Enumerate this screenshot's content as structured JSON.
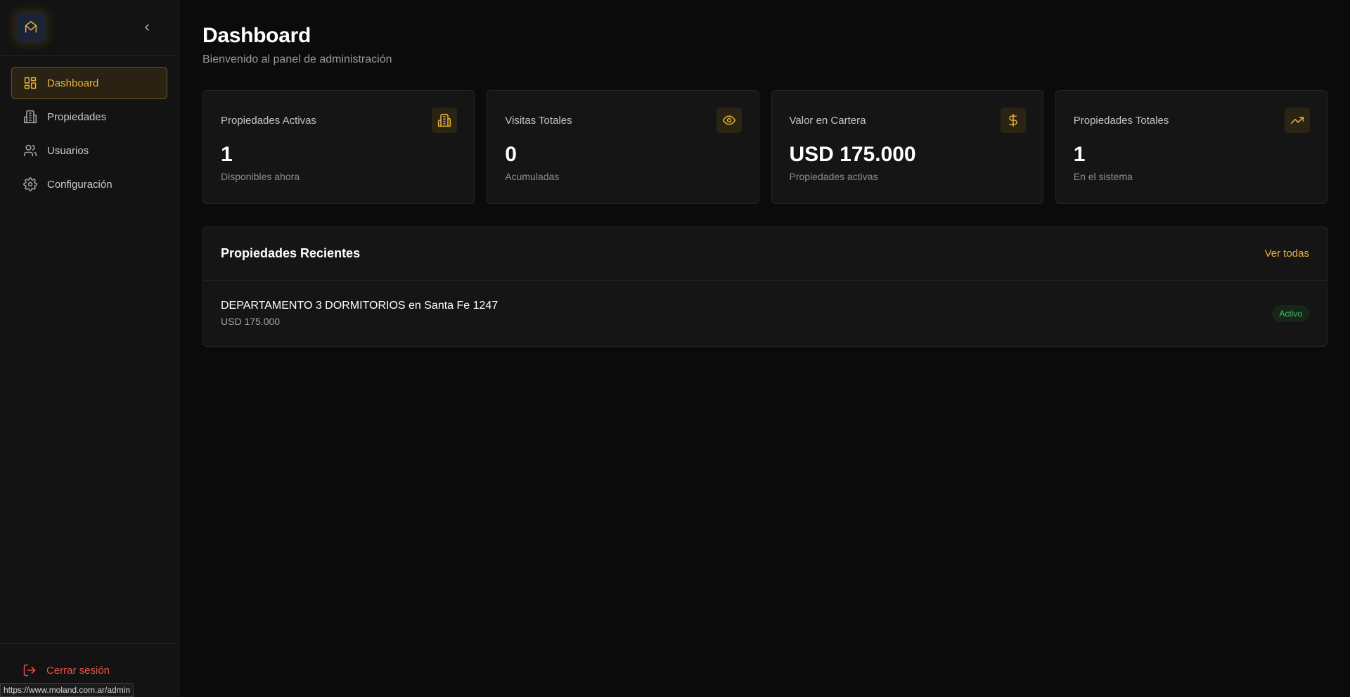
{
  "colors": {
    "accent": "#e8b33a",
    "danger": "#e5534b",
    "success": "#4bc46a",
    "background": "#0b0b0b",
    "sidebar": "#131313"
  },
  "sidebar": {
    "logo_icon": "moland-logo-icon",
    "collapse_icon": "chevron-left-icon",
    "items": [
      {
        "label": "Dashboard",
        "icon": "dashboard-grid-icon",
        "active": true
      },
      {
        "label": "Propiedades",
        "icon": "building-icon",
        "active": false
      },
      {
        "label": "Usuarios",
        "icon": "users-icon",
        "active": false
      },
      {
        "label": "Configuración",
        "icon": "gear-icon",
        "active": false
      }
    ],
    "logout": {
      "label": "Cerrar sesión",
      "icon": "logout-icon"
    }
  },
  "status_bar": {
    "url": "https://www.moland.com.ar/admin"
  },
  "header": {
    "title": "Dashboard",
    "subtitle": "Bienvenido al panel de administración"
  },
  "stats": [
    {
      "label": "Propiedades Activas",
      "value": "1",
      "sub": "Disponibles ahora",
      "icon": "building-icon"
    },
    {
      "label": "Visitas Totales",
      "value": "0",
      "sub": "Acumuladas",
      "icon": "eye-icon"
    },
    {
      "label": "Valor en Cartera",
      "value": "USD 175.000",
      "sub": "Propiedades activas",
      "icon": "dollar-icon"
    },
    {
      "label": "Propiedades Totales",
      "value": "1",
      "sub": "En el sistema",
      "icon": "trending-up-icon"
    }
  ],
  "recent": {
    "title": "Propiedades Recientes",
    "see_all": "Ver todas",
    "items": [
      {
        "name": "DEPARTAMENTO 3 DORMITORIOS en Santa Fe 1247",
        "price": "USD 175.000",
        "status": "Activo"
      }
    ]
  }
}
